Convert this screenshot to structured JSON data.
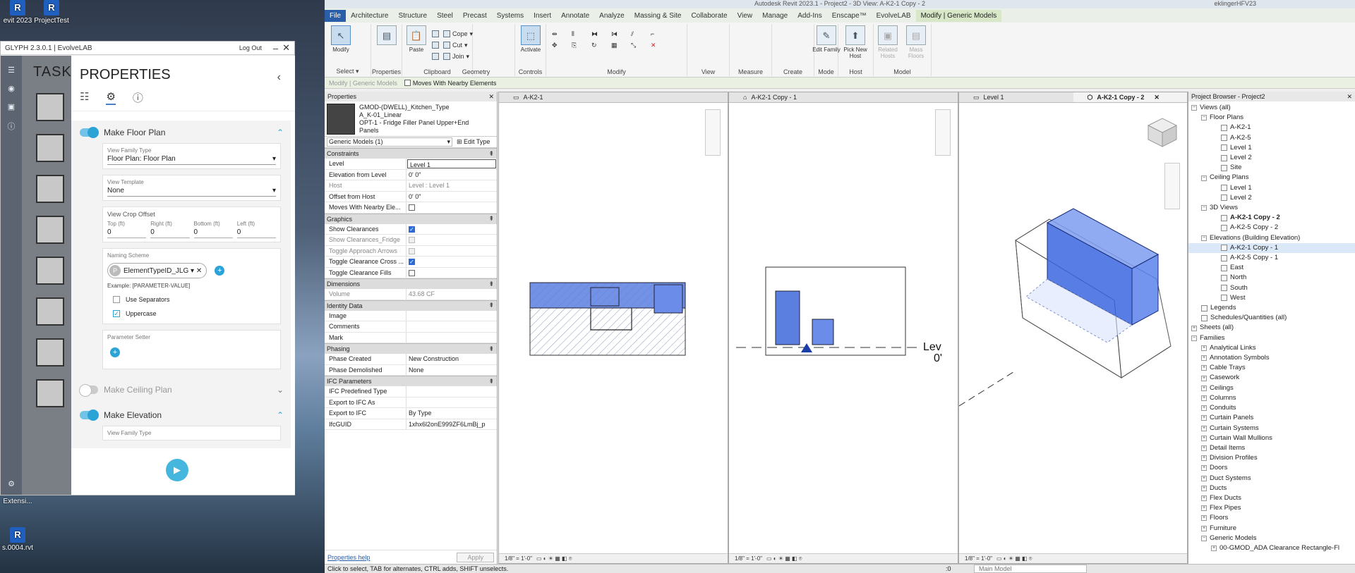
{
  "desktop": {
    "icons": [
      {
        "label": "evit 2023",
        "glyph": "R"
      },
      {
        "label": "ProjectTest",
        "glyph": "R"
      },
      {
        "label": "Extensi...",
        "glyph": ""
      },
      {
        "label": "s.0004.rvt",
        "glyph": "R"
      }
    ]
  },
  "glyph": {
    "title": "GLYPH 2.3.0.1 | EvolveLAB",
    "logout": "Log Out",
    "tasks_title": "TASKS",
    "panel_title": "PROPERTIES",
    "sections": {
      "floor_plan": {
        "label": "Make Floor Plan",
        "enabled": true
      },
      "ceiling_plan": {
        "label": "Make Ceiling Plan",
        "enabled": false
      },
      "elevation": {
        "label": "Make Elevation",
        "enabled": true
      }
    },
    "view_family_type": {
      "label": "View Family Type",
      "value": "Floor Plan: Floor Plan"
    },
    "view_template": {
      "label": "View Template",
      "value": "None"
    },
    "crop_offset": {
      "label": "View Crop Offset",
      "top_label": "Top (ft)",
      "top": "0",
      "right_label": "Right (ft)",
      "right": "0",
      "bottom_label": "Bottom (ft)",
      "bottom": "0",
      "left_label": "Left (ft)",
      "left": "0"
    },
    "naming": {
      "label": "Naming Scheme",
      "chip_initial": "P",
      "chip": "ElementTypeID_JLG",
      "example": "Example: [PARAMETER-VALUE]",
      "use_separators": "Use Separators",
      "uppercase": "Uppercase",
      "uppercase_checked": true
    },
    "param_setter": {
      "label": "Parameter Setter"
    },
    "elevation_vft_label": "View Family Type"
  },
  "revit": {
    "window_title": "Autodesk Revit 2023.1 - Project2 - 3D View: A-K2-1 Copy - 2",
    "user": "eklingerHFV23",
    "menu": [
      "File",
      "Architecture",
      "Structure",
      "Steel",
      "Precast",
      "Systems",
      "Insert",
      "Annotate",
      "Analyze",
      "Massing & Site",
      "Collaborate",
      "View",
      "Manage",
      "Add-Ins",
      "Enscape™",
      "EvolveLAB",
      "Modify | Generic Models"
    ],
    "ribbon": {
      "modify": "Modify",
      "select": "Select",
      "properties": "Properties",
      "clipboard": "Clipboard",
      "paste": "Paste",
      "geometry": "Geometry",
      "cope": "Cope",
      "cut": "Cut",
      "join": "Join",
      "controls": "Controls",
      "activate": "Activate",
      "modify_group": "Modify",
      "view": "View",
      "measure": "Measure",
      "create": "Create",
      "edit_family": "Edit Family",
      "mode": "Mode",
      "pick_new_host": "Pick New Host",
      "host": "Host",
      "related_hosts": "Related Hosts",
      "mass_floors": "Mass Floors",
      "model": "Model"
    },
    "options_bar": {
      "context": "Modify | Generic Models",
      "moves_with": "Moves With Nearby Elements"
    },
    "properties": {
      "header": "Properties",
      "type_lines": [
        "GMOD-(DWELL)_Kitchen_Type",
        "A_K-01_Linear",
        "OPT-1 - Fridge Filler Panel Upper+End",
        "Panels"
      ],
      "selector": "Generic Models (1)",
      "edit_type": "Edit Type",
      "groups": {
        "constraints": "Constraints",
        "graphics": "Graphics",
        "dimensions": "Dimensions",
        "identity": "Identity Data",
        "phasing": "Phasing",
        "ifc": "IFC Parameters"
      },
      "rows": {
        "level": {
          "k": "Level",
          "v": "Level 1"
        },
        "elev": {
          "k": "Elevation from Level",
          "v": "0'  0\""
        },
        "host": {
          "k": "Host",
          "v": "Level : Level 1"
        },
        "offset": {
          "k": "Offset from Host",
          "v": "0'  0\""
        },
        "moves": {
          "k": "Moves With Nearby Ele..."
        },
        "show_clear": {
          "k": "Show Clearances"
        },
        "show_fridge": {
          "k": "Show Clearances_Fridge"
        },
        "toggle_approach": {
          "k": "Toggle Approach Arrows"
        },
        "toggle_cross": {
          "k": "Toggle Clearance Cross ..."
        },
        "toggle_fills": {
          "k": "Toggle Clearance Fills"
        },
        "volume": {
          "k": "Volume",
          "v": "43.68 CF"
        },
        "image": {
          "k": "Image",
          "v": ""
        },
        "comments": {
          "k": "Comments",
          "v": ""
        },
        "mark": {
          "k": "Mark",
          "v": ""
        },
        "phase_created": {
          "k": "Phase Created",
          "v": "New Construction"
        },
        "phase_demolished": {
          "k": "Phase Demolished",
          "v": "None"
        },
        "ifc_type": {
          "k": "IFC Predefined Type",
          "v": ""
        },
        "export_as": {
          "k": "Export to IFC As",
          "v": ""
        },
        "export": {
          "k": "Export to IFC",
          "v": "By Type"
        },
        "guid": {
          "k": "IfcGUID",
          "v": "1xhx6l2onE999ZF6LmBj_p"
        }
      },
      "help": "Properties help",
      "apply": "Apply"
    },
    "views": [
      {
        "tab": "A-K2-1",
        "scale": "1/8\" = 1'-0\""
      },
      {
        "tab": "A-K2-1 Copy - 1",
        "scale": "1/8\" = 1'-0\""
      },
      {
        "tab": "Level 1",
        "scale": ""
      },
      {
        "tab": "A-K2-1 Copy - 2",
        "scale": "1/8\" = 1'-0\""
      }
    ],
    "level_label": "Lev",
    "level_value": "0'",
    "browser": {
      "title": "Project Browser - Project2",
      "views_all": "Views (all)",
      "floor_plans": "Floor Plans",
      "fp_items": [
        "A-K2-1",
        "A-K2-5",
        "Level 1",
        "Level 2",
        "Site"
      ],
      "ceiling_plans": "Ceiling Plans",
      "cp_items": [
        "Level 1",
        "Level 2"
      ],
      "views_3d": "3D Views",
      "v3d_items": [
        "A-K2-1 Copy - 2",
        "A-K2-5 Copy - 2"
      ],
      "elevations": "Elevations (Building Elevation)",
      "el_items": [
        "A-K2-1 Copy - 1",
        "A-K2-5 Copy - 1",
        "East",
        "North",
        "South",
        "West"
      ],
      "legends": "Legends",
      "schedules": "Schedules/Quantities (all)",
      "sheets": "Sheets (all)",
      "families": "Families",
      "fam_items": [
        "Analytical Links",
        "Annotation Symbols",
        "Cable Trays",
        "Casework",
        "Ceilings",
        "Columns",
        "Conduits",
        "Curtain Panels",
        "Curtain Systems",
        "Curtain Wall Mullions",
        "Detail Items",
        "Division Profiles",
        "Doors",
        "Duct Systems",
        "Ducts",
        "Flex Ducts",
        "Flex Pipes",
        "Floors",
        "Furniture"
      ],
      "generic_models": "Generic Models",
      "gm_item": "00-GMOD_ADA Clearance Rectangle-Fl"
    },
    "status": {
      "hint": "Click to select, TAB for alternates, CTRL adds, SHIFT unselects.",
      "model": "Main Model",
      "zero": ":0"
    }
  }
}
